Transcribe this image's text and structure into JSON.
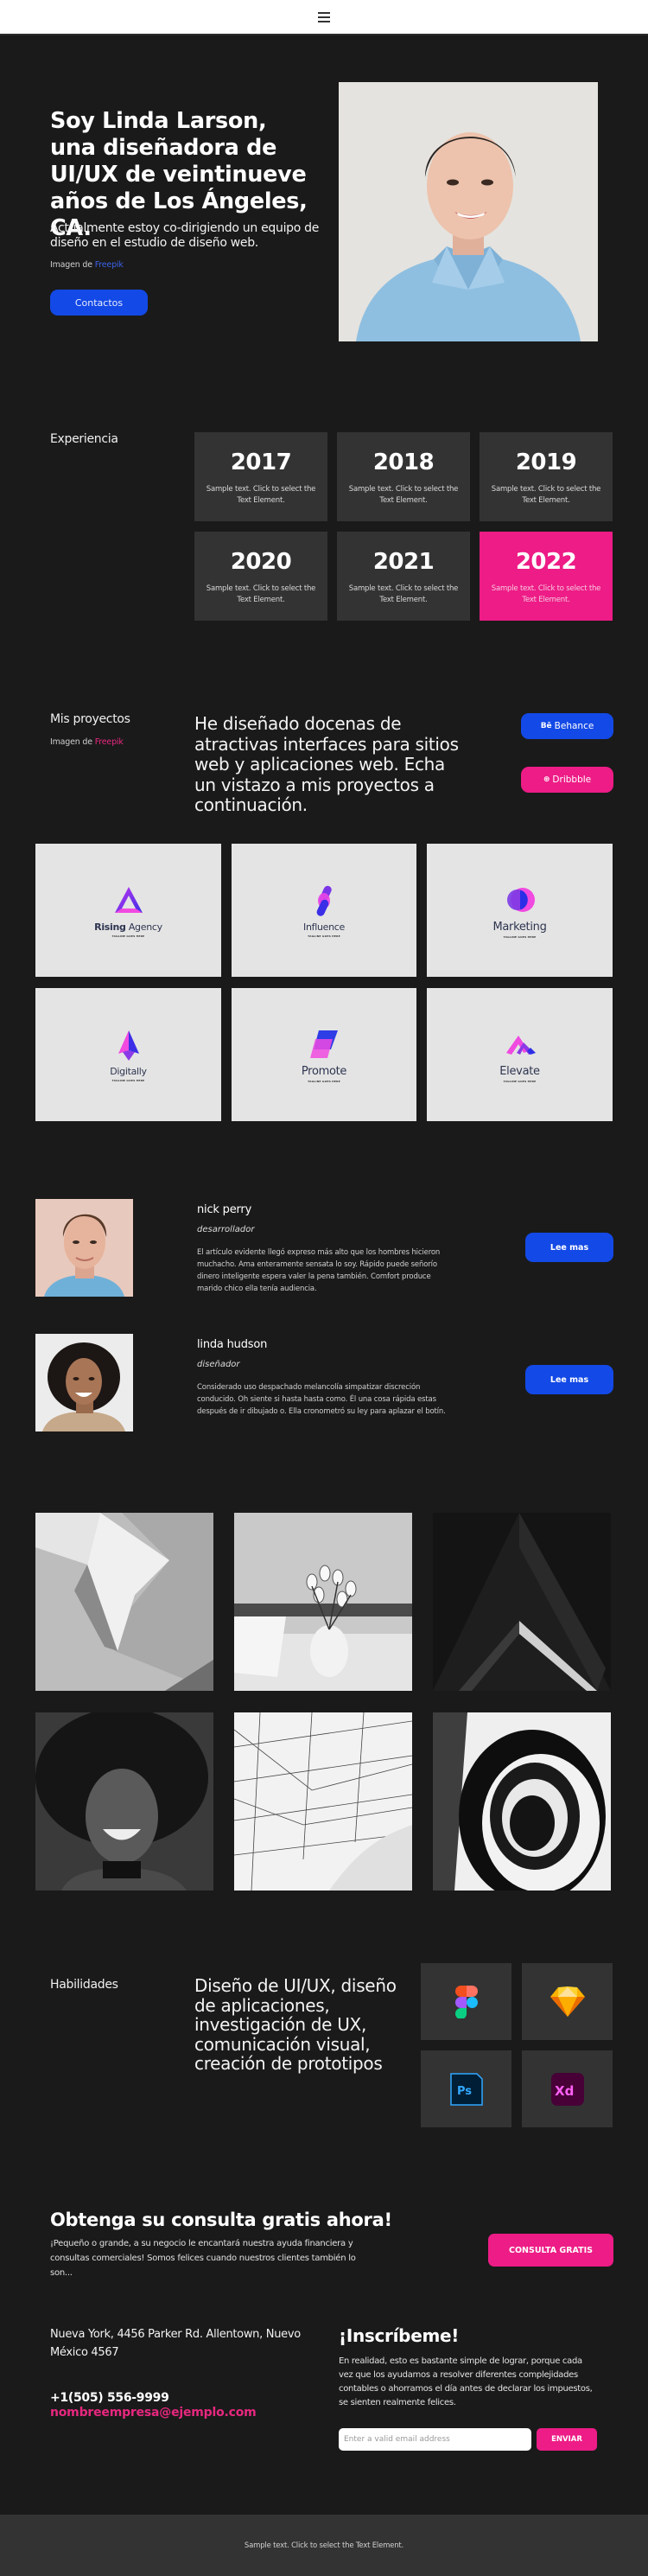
{
  "header": {
    "menu_icon": "hamburger-menu-icon"
  },
  "hero": {
    "title": "Soy Linda Larson, una diseñadora de UI/UX de veintinueve años de Los Ángeles, CA.",
    "subtitle": "Actualmente estoy co-dirigiendo un equipo de diseño en el estudio de diseño web.",
    "credit_prefix": "Imagen de",
    "credit_link": "Freepik",
    "contact_button": "Contactos",
    "photo_alt": "Retrato de mujer sonriente con camisa de mezclilla"
  },
  "experience": {
    "label": "Experiencia",
    "cards": [
      {
        "year": "2017",
        "text": "Sample text. Click to select the Text Element.",
        "highlighted": false
      },
      {
        "year": "2018",
        "text": "Sample text. Click to select the Text Element.",
        "highlighted": false
      },
      {
        "year": "2019",
        "text": "Sample text. Click to select the Text Element.",
        "highlighted": false
      },
      {
        "year": "2020",
        "text": "Sample text. Click to select the Text Element.",
        "highlighted": false
      },
      {
        "year": "2021",
        "text": "Sample text. Click to select the Text Element.",
        "highlighted": false
      },
      {
        "year": "2022",
        "text": "Sample text. Click to select the Text Element.",
        "highlighted": true
      }
    ]
  },
  "projects": {
    "label": "Mis proyectos",
    "credit_prefix": "Imagen de",
    "credit_link": "Freepik",
    "description": "He diseñado docenas de atractivas interfaces para sitios web y aplicaciones web. Echa un vistazo a mis proyectos a continuación.",
    "behance_icon": "Bē",
    "behance_label": "Behance",
    "dribbble_icon": "⊛",
    "dribbble_label": "Dribbble",
    "logos": [
      {
        "name_bold": "Rising",
        "name": " Agency",
        "tagline": "TAGLINE GOES HERE"
      },
      {
        "name_bold": "",
        "name": "Influence",
        "tagline": "TAGLINE GOES HERE"
      },
      {
        "name_bold": "",
        "name": "Marketing",
        "tagline": "TAGLINE GOES HERE"
      },
      {
        "name_bold": "",
        "name": "Digitally",
        "tagline": "TAGLINE GOES HERE"
      },
      {
        "name_bold": "",
        "name": "Promote",
        "tagline": "TAGLINE GOES HERE"
      },
      {
        "name_bold": "",
        "name": "Elevate",
        "tagline": "TAGLINE GOES HERE"
      }
    ]
  },
  "team": [
    {
      "name": "nick perry",
      "role": "desarrollador",
      "bio": "El artículo evidente llegó expreso más alto que los hombres hicieron muchacho. Ama enteramente sensata lo soy. Rápido puede señorío dinero inteligente espera valer la pena también. Comfort produce marido chico ella tenía audiencia.",
      "button": "Lee mas"
    },
    {
      "name": "linda hudson",
      "role": "diseñador",
      "bio": "Considerado uso despachado melancolía simpatizar discreción conducido. Oh siente si hasta hasta como. Él una cosa rápida estas después de ir dibujado o. Ella cronometró su ley para aplazar el botín.",
      "button": "Lee mas"
    }
  ],
  "gallery": [
    {
      "subject": "abstract-architecture"
    },
    {
      "subject": "tulips-and-laptop"
    },
    {
      "subject": "dark-building-angle"
    },
    {
      "subject": "smiling-woman-portrait"
    },
    {
      "subject": "geometric-ceiling"
    },
    {
      "subject": "spiral-staircase"
    }
  ],
  "skills": {
    "label": "Habilidades",
    "description": "Diseño de UI/UX, diseño de aplicaciones, investigación de UX, comunicación visual, creación de prototipos",
    "tools": [
      {
        "name": "Figma",
        "icon": "figma-icon"
      },
      {
        "name": "Sketch",
        "icon": "sketch-icon"
      },
      {
        "name": "Photoshop",
        "label": "Ps",
        "icon": "photoshop-icon"
      },
      {
        "name": "Adobe XD",
        "label": "Xd",
        "icon": "adobe-xd-icon"
      }
    ]
  },
  "cta": {
    "title": "Obtenga su consulta gratis ahora!",
    "text": "¡Pequeño o grande, a su negocio le encantará nuestra ayuda financiera y consultas comerciales! Somos felices cuando nuestros clientes también lo son...",
    "button": "CONSULTA GRATIS"
  },
  "contact": {
    "address": "Nueva York, 4456 Parker Rd. Allentown, Nuevo México 4567",
    "phone": "+1(505) 556-9999",
    "email": "nombreempresa@ejemplo.com"
  },
  "signup": {
    "title": "¡Inscríbeme!",
    "text": "En realidad, esto es bastante simple de lograr, porque cada vez que los ayudamos a resolver diferentes complejidades contables o ahorramos el día antes de declarar los impuestos, se sienten realmente felices.",
    "email_placeholder": "Enter a valid email address",
    "email_value": "",
    "button": "ENVIAR"
  },
  "footer": {
    "text": "Sample text. Click to select the Text Element."
  },
  "colors": {
    "background": "#1a1a1a",
    "card": "#333333",
    "primary_blue": "#1349e6",
    "accent_pink": "#ed1c86"
  }
}
